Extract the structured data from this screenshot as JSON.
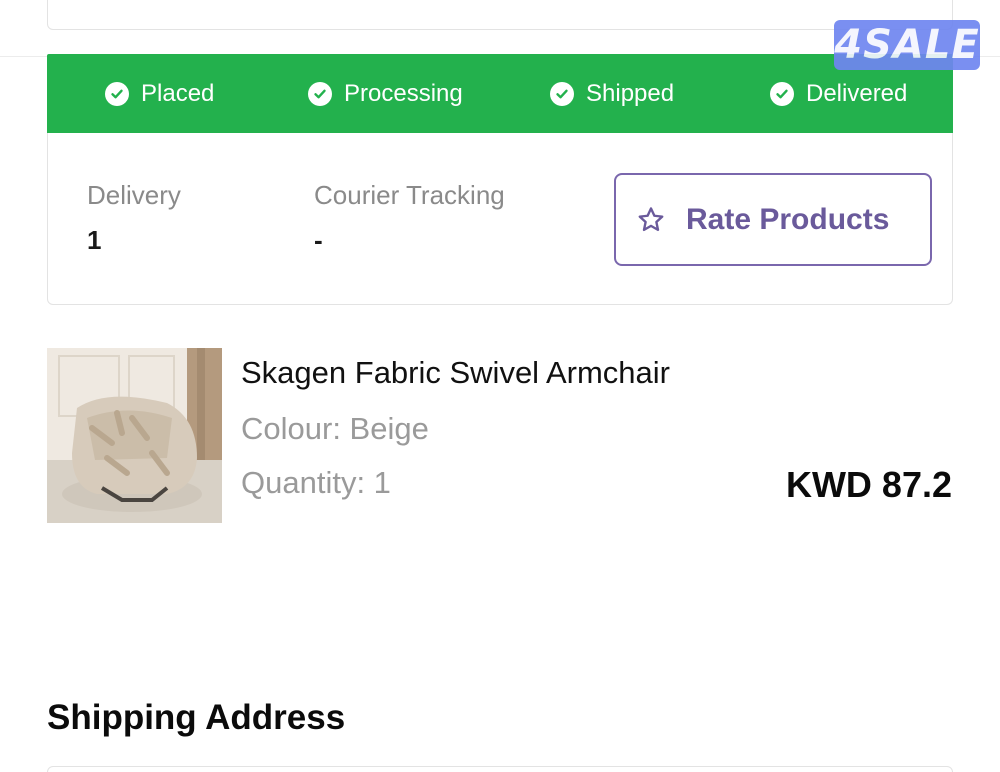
{
  "watermark": {
    "text": "4SALE"
  },
  "status_steps": [
    {
      "label": "Placed",
      "done": true
    },
    {
      "label": "Processing",
      "done": true
    },
    {
      "label": "Shipped",
      "done": true
    },
    {
      "label": "Delivered",
      "done": true
    }
  ],
  "colors": {
    "status_green": "#23b14d",
    "rate_purple": "#6a5a9b",
    "muted_text": "#8a8a8a"
  },
  "order_info": {
    "delivery_label": "Delivery",
    "delivery_value": "1",
    "tracking_label": "Courier Tracking",
    "tracking_value": "-",
    "rate_button_label": "Rate Products",
    "rate_icon": "star-icon"
  },
  "product": {
    "name": "Skagen Fabric Swivel Armchair",
    "colour": "Colour: Beige",
    "quantity": "Quantity: 1",
    "price": "KWD 87.2",
    "image_icon": "armchair-photo"
  },
  "shipping": {
    "title": "Shipping Address"
  }
}
